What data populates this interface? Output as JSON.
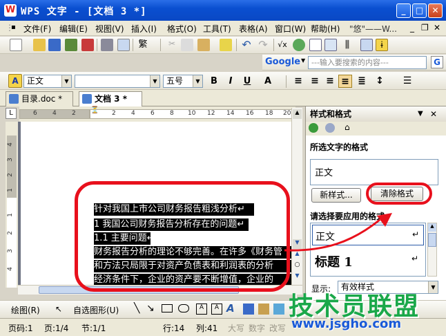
{
  "titlebar": {
    "title": "WPS 文字 - [文档 3 *]",
    "app_icon": "W"
  },
  "menu": {
    "items": [
      "文件(F)",
      "编辑(E)",
      "视图(V)",
      "插入(I)",
      "格式(O)",
      "工具(T)",
      "表格(A)",
      "窗口(W)",
      "帮助(H)",
      "\"悠\"——W..."
    ]
  },
  "search": {
    "engine": "Google",
    "placeholder": "---输入要搜索的内容---",
    "g_label": "G"
  },
  "format_bar": {
    "style": "正文",
    "font": "",
    "size": "五号",
    "bold": "B",
    "italic": "I",
    "underline": "U",
    "fontcolor": "A"
  },
  "tabs": [
    {
      "label": "目录.doc *"
    },
    {
      "label": "文档 3 *"
    }
  ],
  "ruler": {
    "h_ticks": [
      "6",
      "4",
      "2",
      "2",
      "4",
      "6",
      "8",
      "10",
      "12",
      "14",
      "16",
      "18",
      "20"
    ],
    "v_ticks": [
      "4",
      "3",
      "2",
      "1",
      "1",
      "2",
      "3",
      "4"
    ]
  },
  "document": {
    "lines": [
      "针对我国上市公司财务报告粗浅分析↵",
      "1 我国公司财务报告分析存在的问题↵",
      "1.1 主要问题↵",
      "财务报告分析的理论不够完善。在许多《财务管",
      "和方法只局限于对资产负债表和利润表的分析",
      "经济条件下，企业的资产要不断增值，企业的"
    ]
  },
  "taskpane": {
    "title": "样式和格式",
    "selected_label": "所选文字的格式",
    "current_style": "正文",
    "new_style_btn": "新样式...",
    "clear_format_btn": "清除格式",
    "apply_label": "请选择要应用的格式",
    "styles": [
      {
        "name": "正文",
        "mark": "↵"
      },
      {
        "name": "标题 1",
        "mark": "↵"
      }
    ],
    "show_label": "显示:",
    "show_value": "有效样式"
  },
  "drawbar": {
    "draw_label": "绘图(R)",
    "autoshape_label": "自选图形(U)"
  },
  "status": {
    "page_no": "页码:1",
    "page": "页:1/4",
    "section": "节:1/1",
    "row": "行:14",
    "col": "列:41",
    "caps": "大写",
    "num": "数字",
    "ovr": "改写"
  },
  "watermark": {
    "cn": "技术员联盟",
    "url": "www.jsgho.com"
  },
  "colors": {
    "title_blue": "#0a4fd0",
    "annotation_red": "#e8101c",
    "watermark_green": "#1aa84a",
    "watermark_blue": "#1a5ad8"
  }
}
